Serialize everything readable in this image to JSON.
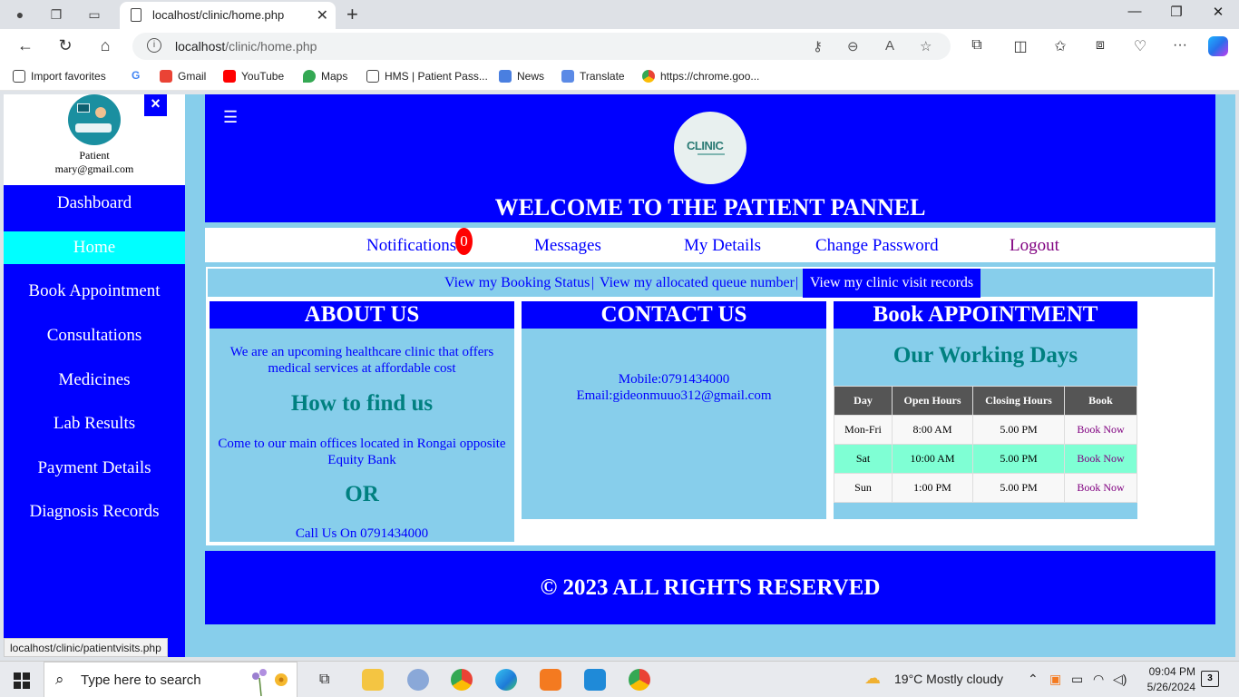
{
  "browser": {
    "tab_title": "localhost/clinic/home.php",
    "url_host": "localhost",
    "url_path": "/clinic/home.php",
    "favorites": [
      {
        "label": "Import favorites",
        "icon": "import-icon"
      },
      {
        "label": "Gmail",
        "icon": "gmail-icon"
      },
      {
        "label": "YouTube",
        "icon": "youtube-icon"
      },
      {
        "label": "Maps",
        "icon": "maps-icon"
      },
      {
        "label": "HMS | Patient Pass...",
        "icon": "page-icon"
      },
      {
        "label": "News",
        "icon": "news-icon"
      },
      {
        "label": "Translate",
        "icon": "translate-icon"
      },
      {
        "label": "https://chrome.goo...",
        "icon": "chrome-icon"
      }
    ],
    "status_url": "localhost/clinic/patientvisits.php"
  },
  "sidebar": {
    "role": "Patient",
    "email": "mary@gmail.com",
    "close_label": "×",
    "items": [
      {
        "label": "Dashboard",
        "active": false
      },
      {
        "label": "Home",
        "active": true
      },
      {
        "label": "Book Appointment",
        "active": false
      },
      {
        "label": "Consultations",
        "active": false
      },
      {
        "label": "Medicines",
        "active": false
      },
      {
        "label": "Lab Results",
        "active": false
      },
      {
        "label": "Payment Details",
        "active": false
      },
      {
        "label": "Diagnosis Records",
        "active": false
      }
    ]
  },
  "header": {
    "menu_glyph": "☰",
    "logo_text": "CLINIC",
    "welcome": "WELCOME TO THE PATIENT PANNEL"
  },
  "topnav": {
    "notifications": "Notifications",
    "notif_count": "0",
    "messages": "Messages",
    "my_details": "My Details",
    "change_password": "Change Password",
    "logout": "Logout"
  },
  "subnav": {
    "booking_status": "View my Booking Status",
    "queue_number": "View my allocated queue number",
    "visit_records": "View my clinic visit records",
    "separator": "|"
  },
  "about": {
    "title": "ABOUT US",
    "text": "We are an upcoming healthcare clinic that offers medical services at affordable cost",
    "find_title": "How to find us",
    "find_text": "Come to our main offices located in Rongai opposite Equity Bank",
    "or": "OR",
    "call": "Call Us On 0791434000"
  },
  "contact": {
    "title": "CONTACT US",
    "mobile": "Mobile:0791434000",
    "email": "Email:gideonmuuo312@gmail.com"
  },
  "appointment": {
    "title": "Book APPOINTMENT",
    "subtitle": "Our Working Days",
    "headers": [
      "Day",
      "Open Hours",
      "Closing Hours",
      "Book"
    ],
    "rows": [
      {
        "day": "Mon-Fri",
        "open": "8:00 AM",
        "close": "5.00 PM",
        "book": "Book Now"
      },
      {
        "day": "Sat",
        "open": "10:00 AM",
        "close": "5.00 PM",
        "book": "Book Now"
      },
      {
        "day": "Sun",
        "open": "1:00 PM",
        "close": "5.00 PM",
        "book": "Book Now"
      }
    ]
  },
  "footer": {
    "text": "© 2023 ALL RIGHTS RESERVED"
  },
  "taskbar": {
    "search_placeholder": "Type here to search",
    "weather": "19°C  Mostly cloudy",
    "time": "09:04 PM",
    "date": "5/26/2024",
    "notif_count": "3"
  },
  "colors": {
    "primary_blue": "#0000ff",
    "sky_blue": "#87ceeb",
    "active_cyan": "#00ffff",
    "teal": "#008080",
    "badge_red": "#ff0000"
  }
}
